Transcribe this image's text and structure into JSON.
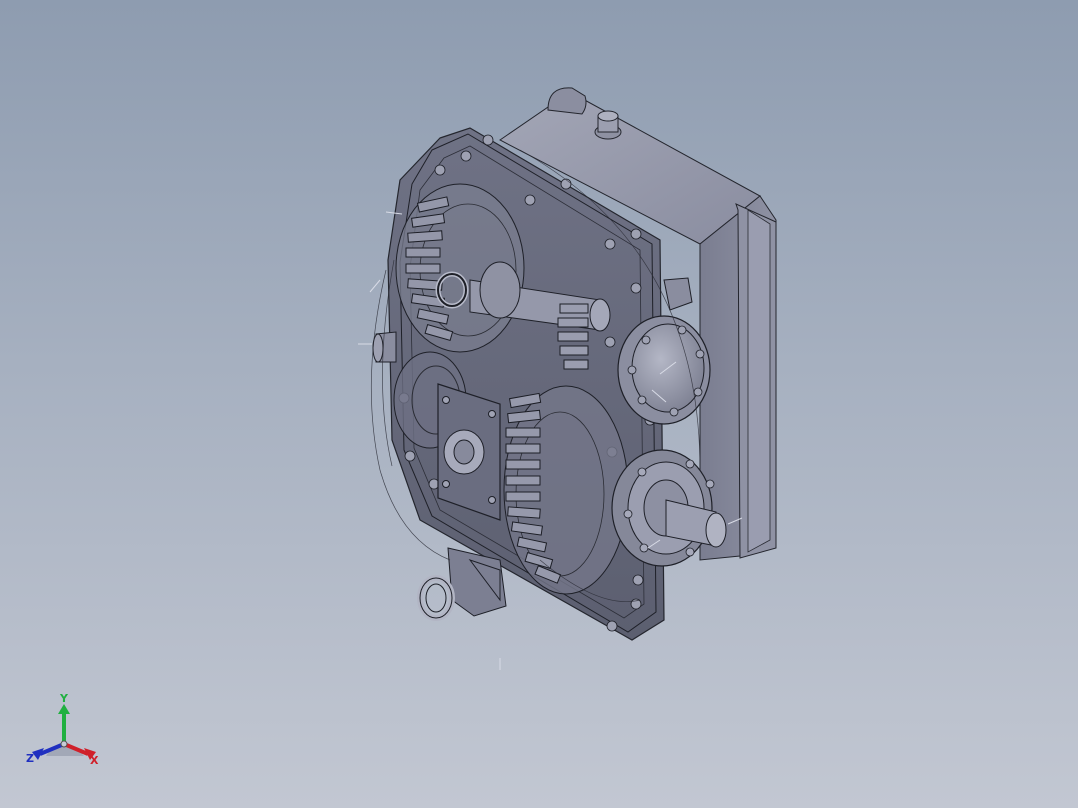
{
  "viewport": {
    "background_top": "#8e9cb0",
    "background_bottom": "#c2c7d2",
    "model_color": "#7f8296",
    "edge_color": "#22242c"
  },
  "triad": {
    "x_label": "X",
    "y_label": "Y",
    "z_label": "Z",
    "x_color": "#d0202a",
    "y_color": "#20b040",
    "z_color": "#2030c0"
  }
}
